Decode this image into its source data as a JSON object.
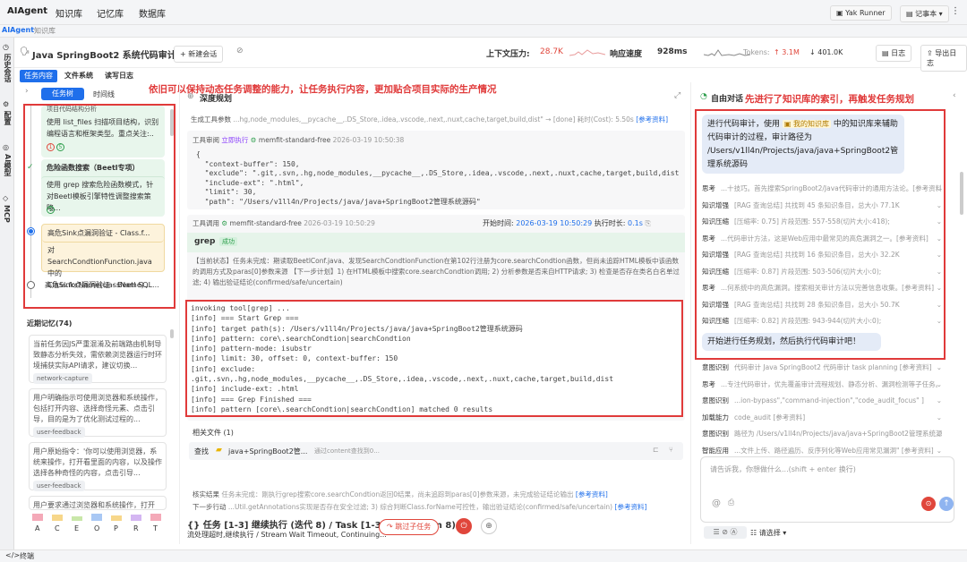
{
  "topnav": {
    "brand": "AIAgent",
    "items": [
      "知识库",
      "记忆库",
      "数据库"
    ],
    "yak": "Yak Runner",
    "notebook": "记事本"
  },
  "subtabs": [
    "AIAgent",
    "知识库"
  ],
  "sidebar": [
    "历史会话",
    "配置",
    "AI模型",
    "MCP"
  ],
  "header": {
    "title": "Java SpringBoot2 系统代码审计",
    "new_session": "+ 新建会话",
    "ctx_label": "上下文压力:",
    "ctx_value": "28.7K",
    "speed_label": "响应速度",
    "speed_value": "928ms",
    "tokens_label": "Tokens:",
    "tokens_up": "↑ 3.1M",
    "tokens_down": "↓ 401.0K",
    "log": "日志",
    "export": "导出日志"
  },
  "left_tabs": [
    "任务内容",
    "文件系统",
    "读写日志"
  ],
  "tree_tabs": [
    "任务树",
    "时间线"
  ],
  "tasks": [
    {
      "title": "项目代码结构分析",
      "body": "使用 list_files 扫描项目结构，识别编程语言和框架类型。重点关注:..",
      "n1": "1",
      "n2": "5"
    },
    {
      "title": "危险函数搜索（Beetl专项）",
      "body": "使用 grep 搜索危险函数模式，针对Beetl模板引擎特性调整搜索策略...",
      "n2": "5"
    },
    {
      "title": "高危Sink点漏洞验证 - Class.f...",
      "body": "对SearchCondtionFunction.java中的Class.forName(className)..."
    },
    {
      "title": "高危Sink点漏洞验证 - Beetl SQL..."
    }
  ],
  "memory": {
    "title": "近期记忆(74)",
    "items": [
      {
        "text": "当前任务因JS严重混淆及前端路由机制导致静态分析失效，需依赖浏览器运行时环境捕获实际API请求，建议切换...",
        "tag": "network-capture"
      },
      {
        "text": "用户明确指示可使用浏览器和系统操作，包括打开内容、选择奇怪元素、点击引导，目的是为了优化测试过程的...",
        "tag": "user-feedback"
      },
      {
        "text": "用户原始指令：'你可以使用浏览器，系统来操作，打开看里面的内容，以及操作选择各种奇怪的内容，点击引导...",
        "tag": "user-feedback"
      },
      {
        "text": "用户要求通过浏览器和系统操作，打开"
      }
    ],
    "letters": [
      "A",
      "C",
      "E",
      "O",
      "P",
      "R",
      "T"
    ]
  },
  "annot1": "依旧可以保持动态任务调整的能力，让任务执行内容，更加贴合项目实际的生产情况",
  "annot2": "先进行了知识库的索引，再触发任务规划",
  "mid": {
    "title": "深度规划",
    "gen": "生成工具参数",
    "gen_detail": "...hg,node_modules,__pycache__,.DS_Store,.idea,.vscode,.next,.nuxt,cache,target,build,dist\" → [done] 耗时(Cost): 5.50s",
    "ref": "[参考资料]",
    "review": "工具审阅",
    "exec": "立即执行",
    "model": "memfit-standard-free",
    "time1": "2026-03-19 10:50:38",
    "code1": "{\n  \"context-buffer\": 150,\n  \"exclude\": \".git,.svn,.hg,node_modules,__pycache__,.DS_Store,.idea,.vscode,.next,.nuxt,cache,target,build,dist\",\n  \"include-ext\": \".html\",\n  \"limit\": 30,\n  \"path\": \"/Users/v1ll4n/Projects/java/java+SpringBoot2管理系统源码\"",
    "call": "工具调用",
    "time2": "2026-03-19 10:50:29",
    "start_label": "开始时间:",
    "start_time": "2026-03-19 10:50:29",
    "dur_label": "执行时长:",
    "dur": "0.1s",
    "grep": "grep",
    "success": "成功",
    "desc": "【当前状态】任务未完成：期读取BeetlConf.java、发现SearchCondtionFunction在第102行注册为core.searchCondtion函数，但尚未追踪HTML模板中该函数的调用方式及paras[0]参数来源 【下一步计划】1) 在HTML模板中搜索core.searchCondtion调用; 2) 分析参数是否来自HTTP请求; 3) 检查是否存在类名白名单过滤; 4) 输出验证结论(confirmed/safe/uncertain)",
    "code2": "invoking tool[grep] ...\n[info] === Start Grep ===\n[info] target path(s): /Users/v1ll4n/Projects/java/java+SpringBoot2管理系统源码\n[info] pattern: core\\.searchCondtion|searchCondtion\n[info] pattern-mode: isubstr\n[info] limit: 30, offset: 0, context-buffer: 150\n[info] exclude:\n.git,.svn,.hg,node_modules,__pycache__,.DS_Store,.idea,.vscode,.next,.nuxt,cache,target,build,dist\n[info] include-ext: .html\n[info] === Grep Finished ===\n[info] pattern [core\\.searchCondtion|searchCondtion] matched 0 results",
    "files_title": "相关文件 (1)",
    "search": "查找",
    "folder": "java+SpringBoot2管...",
    "via": "通过content查找到0...",
    "verify_label": "核实结果",
    "verify": "任务未完成：刚执行grep搜索core.searchCondtion返回0结果，尚未追踪到paras[0]参数来源，未完成验证结论输出",
    "next_label": "下一步行动",
    "next": "...Util.getAnnotations实现是否存在安全过滤; 3) 综合判断Class.forName可控性，输出验证结论(confirmed/safe/uncertain)",
    "bottom1": "{} 任务 [1-3] 继续执行 (迭代 8) / Task [1-3] ...iteration 8)",
    "bottom2": "流处理超时,继续执行 / Stream Wait Timeout, Continuing...",
    "skip": "跳过子任务"
  },
  "right": {
    "title": "自由对话",
    "msg1a": "进行代码审计，使用",
    "kb": "我的知识库",
    "msg1b": "中的知识库来辅助代码审计的过程，审计路径为 /Users/v1ll4n/Projects/java/java+SpringBoot2管理系统源码",
    "rows": [
      [
        "思考",
        "...十技巧。首先搜索SpringBoot2/Java代码审计的通用方法论。[参考资料]"
      ],
      [
        "知识增强",
        "[RAG 查询总结] 共找到 45 条知识条目，总大小 77.1K"
      ],
      [
        "知识压缩",
        "[压缩率: 0.75] 片段范围: 557-558(切片大小:418);"
      ],
      [
        "思考",
        "...代码审计方法，这是Web应用中最常见的高危漏洞之一。[参考资料]"
      ],
      [
        "知识增强",
        "[RAG 查询总结] 共找到 16 条知识条目，总大小 32.2K"
      ],
      [
        "知识压缩",
        "[压缩率: 0.87] 片段范围: 503-506(切片大小:0);"
      ],
      [
        "思考",
        "...何系统中的高危漏洞。搜索相关审计方法以完善信息收集。[参考资料]"
      ],
      [
        "知识增强",
        "[RAG 查询总结] 共找到 28 条知识条目，总大小 50.7K"
      ],
      [
        "知识压缩",
        "[压缩率: 0.82] 片段范围: 943-944(切片大小:0);"
      ]
    ],
    "msg2": "开始进行任务规划，然后执行代码审计吧！",
    "rows2": [
      [
        "意图识别",
        "代码审计 Java SpringBoot2 代码审计 task planning [参考资料]"
      ],
      [
        "思考",
        "...专注代码审计，优先覆盖审计流程规划、静态分析、漏洞检测等子任务。"
      ],
      [
        "意图识别",
        "...ion-bypass\",\"command-injection\",\"code_audit_focus\" ]"
      ],
      [
        "加载能力",
        "code_audit [参考资料]"
      ],
      [
        "意图识别",
        "路径为 /Users/v1ll4n/Projects/java/java+SpringBoot2管理系统源码。"
      ],
      [
        "智能应用",
        "...文件上传、路径遍历、反序列化等Web应用常见漏洞\" [参考资料]"
      ]
    ],
    "placeholder": "请告诉我，你想做什么...(shift + enter 换行)",
    "select": "请选择"
  },
  "terminal": "终端"
}
